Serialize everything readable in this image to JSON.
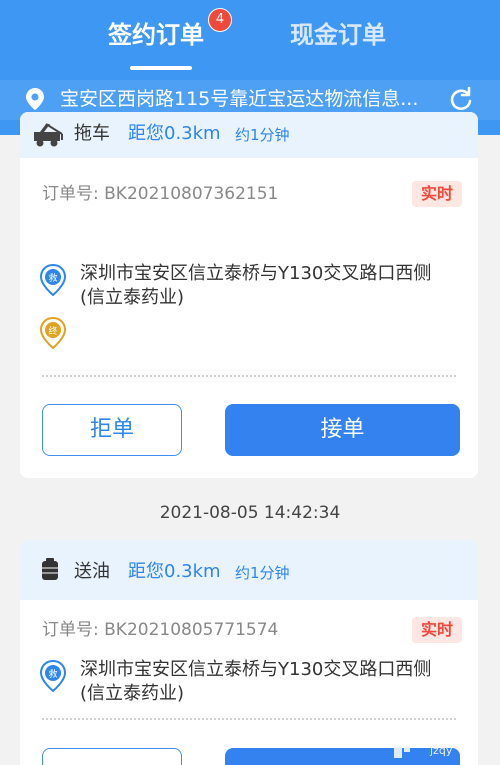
{
  "tabs": {
    "signed_orders": "签约订单",
    "signed_badge": "4",
    "cash_orders": "现金订单"
  },
  "location": {
    "text": "宝安区西岗路115号靠近宝运达物流信息..."
  },
  "orders": [
    {
      "service": "拖车",
      "service_icon": "tow-truck-icon",
      "distance": "距您0.3km",
      "eta": "约1分钟",
      "order_no": "订单号: BK20210807362151",
      "tag": "实时",
      "start_marker": "救",
      "end_marker": "终",
      "address_line1": "深圳市宝安区信立泰桥与Y130交叉路口西侧",
      "address_line2": "(信立泰药业)",
      "reject_label": "拒单",
      "accept_label": "接单"
    },
    {
      "service": "送油",
      "service_icon": "oil-drum-icon",
      "distance": "距您0.3km",
      "eta": "约1分钟",
      "order_no": "订单号: BK20210805771574",
      "tag": "实时",
      "start_marker": "救",
      "address_line1": "深圳市宝安区信立泰桥与Y130交叉路口西侧",
      "address_line2": "(信立泰药业)",
      "timestamp": "2021-08-05 14:42:34"
    }
  ],
  "watermark": "jzqy",
  "colors": {
    "primary": "#3f97f4",
    "accent_button": "#3382ef",
    "tag_red": "#f0493c",
    "card_header": "#e9f3fe"
  }
}
